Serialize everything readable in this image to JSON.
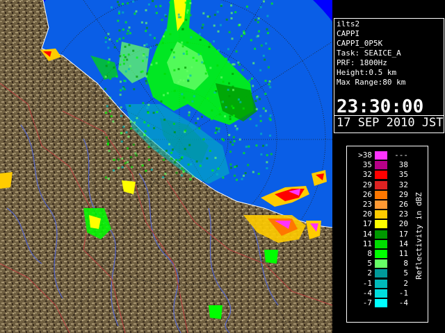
{
  "info": {
    "station": "ilts2",
    "product": "CAPPI",
    "product_id": "CAPPI_0P5K",
    "task": "Task: SEAICE_A",
    "prf": "PRF: 1800Hz",
    "height": "Height:0.5 km",
    "max_range": "Max Range:80 km",
    "time": "23:30:00",
    "date": "17 SEP 2010 JST"
  },
  "legend": {
    "unit_label": "Reflectivity in dBZ",
    "rows": [
      {
        "low": ">38",
        "high": "---",
        "color": "#ff33ff"
      },
      {
        "low": "35",
        "high": "38",
        "color": "#b70088"
      },
      {
        "low": "32",
        "high": "35",
        "color": "#ff0000"
      },
      {
        "low": "29",
        "high": "32",
        "color": "#dd2222"
      },
      {
        "low": "26",
        "high": "29",
        "color": "#ff7700"
      },
      {
        "low": "23",
        "high": "26",
        "color": "#ff9933"
      },
      {
        "low": "20",
        "high": "23",
        "color": "#ffcc00"
      },
      {
        "low": "17",
        "high": "20",
        "color": "#ffff00"
      },
      {
        "low": "14",
        "high": "17",
        "color": "#009900"
      },
      {
        "low": "11",
        "high": "14",
        "color": "#00dd00"
      },
      {
        "low": "8",
        "high": "11",
        "color": "#00ff00"
      },
      {
        "low": "5",
        "high": "8",
        "color": "#66ff66"
      },
      {
        "low": "2",
        "high": "5",
        "color": "#009999"
      },
      {
        "low": "-1",
        "high": "2",
        "color": "#00bbbb"
      },
      {
        "low": "-4",
        "high": "-1",
        "color": "#00dddd"
      },
      {
        "low": "-7",
        "high": "-4",
        "color": "#00ffff"
      }
    ]
  },
  "colors": {
    "sea": "#0a5ee6",
    "sea_echo": "#1f78f0",
    "outside_range": "#0000ff",
    "land_light": "#8a7a58",
    "land_dark": "#4a3a26",
    "river": "#5566cc",
    "boundary": "#c04040"
  }
}
